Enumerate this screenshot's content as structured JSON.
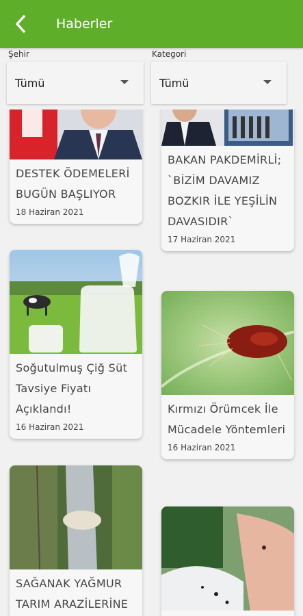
{
  "header": {
    "title": "Haberler",
    "back_icon": "chevron-left-icon",
    "color": "#5fae2a"
  },
  "filters": {
    "city": {
      "label": "Şehir",
      "value": "Tümü"
    },
    "category": {
      "label": "Kategori",
      "value": "Tümü"
    }
  },
  "news": [
    {
      "title": "DESTEK ÖDEMELERİ BUGÜN BAŞLIYOR",
      "date": "18 Haziran 2021"
    },
    {
      "title": "BAKAN PAKDEMİRLİ; `BİZİM DAVAMIZ BOZKIR İLE YEŞİLİN DAVASIDIR`",
      "date": "17 Haziran 2021"
    },
    {
      "title": "Soğutulmuş Çiğ Süt Tavsiye Fiyatı Açıklandı!",
      "date": "16 Haziran 2021"
    },
    {
      "title": "Kırmızı Örümcek İle Mücadele Yöntemleri",
      "date": "16 Haziran 2021"
    },
    {
      "title": "SAĞANAK YAĞMUR TARIM ARAZİLERİNE",
      "date": ""
    },
    {
      "title": "",
      "date": ""
    }
  ]
}
